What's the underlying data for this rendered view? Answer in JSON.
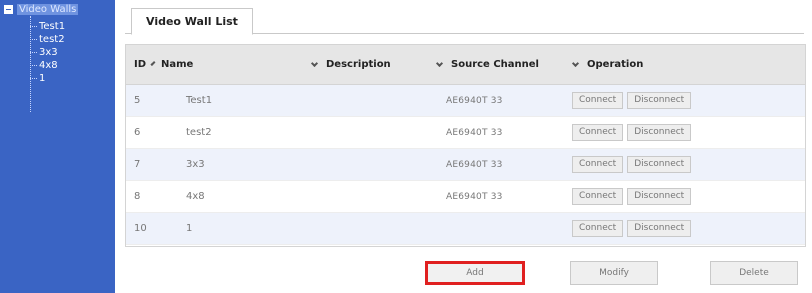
{
  "sidebar": {
    "root_label": "Video Walls",
    "items": [
      {
        "label": "Test1"
      },
      {
        "label": "test2"
      },
      {
        "label": "3x3"
      },
      {
        "label": "4x8"
      },
      {
        "label": "1"
      }
    ]
  },
  "tabs": [
    {
      "label": "Video Wall List"
    }
  ],
  "table": {
    "headers": {
      "id": "ID",
      "name": "Name",
      "description": "Description",
      "source_channel": "Source Channel",
      "operation": "Operation"
    },
    "rows": [
      {
        "id": "5",
        "name": "Test1",
        "description": "",
        "source": "AE6940T 33",
        "connect": "Connect",
        "disconnect": "Disconnect"
      },
      {
        "id": "6",
        "name": "test2",
        "description": "",
        "source": "AE6940T 33",
        "connect": "Connect",
        "disconnect": "Disconnect"
      },
      {
        "id": "7",
        "name": "3x3",
        "description": "",
        "source": "AE6940T 33",
        "connect": "Connect",
        "disconnect": "Disconnect"
      },
      {
        "id": "8",
        "name": "4x8",
        "description": "",
        "source": "AE6940T 33",
        "connect": "Connect",
        "disconnect": "Disconnect"
      },
      {
        "id": "10",
        "name": "1",
        "description": "",
        "source": "",
        "connect": "Connect",
        "disconnect": "Disconnect"
      }
    ]
  },
  "actions": {
    "add": "Add",
    "modify": "Modify",
    "delete": "Delete"
  },
  "colors": {
    "sidebar_bg": "#3a64c4",
    "highlight": "#e02020",
    "row_alt": "#eef2fb"
  }
}
